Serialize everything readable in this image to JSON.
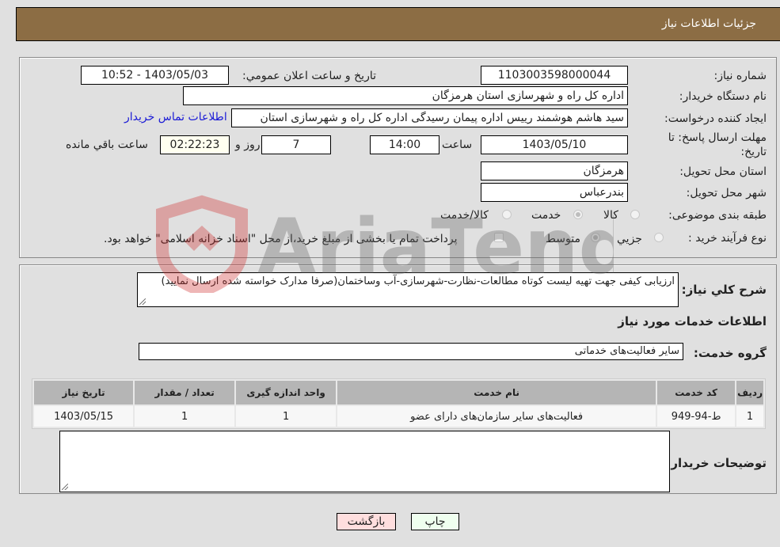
{
  "header": {
    "title": "جزئیات اطلاعات نیاز"
  },
  "form": {
    "need_number": {
      "label": "شماره نیاز:",
      "value": "1103003598000044"
    },
    "announce_datetime": {
      "label": "تاریخ و ساعت اعلان عمومي:",
      "value": "1403/05/03 - 10:52"
    },
    "buyer_org": {
      "label": "نام دستگاه خریدار:",
      "value": "اداره کل راه و شهرسازی استان هرمزگان"
    },
    "requester": {
      "label": "ایجاد کننده درخواست:",
      "value": "سید هاشم هوشمند رییس اداره پیمان رسیدگی اداره کل راه و شهرسازی استان",
      "contact_link": "اطلاعات تماس خریدار"
    },
    "deadline": {
      "label": "مهلت ارسال پاسخ: تا تاریخ:",
      "date": "1403/05/10",
      "time_label": "ساعت",
      "time": "14:00",
      "days": "7",
      "days_label": "روز و",
      "remaining": "02:22:23",
      "remaining_label": "ساعت باقي مانده"
    },
    "delivery_province": {
      "label": "استان محل تحویل:",
      "value": "هرمزگان"
    },
    "delivery_city": {
      "label": "شهر محل تحویل:",
      "value": "بندرعباس"
    },
    "category": {
      "label": "طبقه بندی موضوعی:",
      "options": [
        {
          "label": "کالا",
          "checked": false
        },
        {
          "label": "خدمت",
          "checked": true
        },
        {
          "label": "کالا/خدمت",
          "checked": false
        }
      ]
    },
    "purchase_type": {
      "label": "نوع فرآیند خرید :",
      "options": [
        {
          "label": "جزیي",
          "checked": false
        },
        {
          "label": "متوسط",
          "checked": true
        }
      ],
      "treasury_checkbox_label": "پرداخت تمام یا بخشی از مبلغ خرید،از محل \"اسناد خزانه اسلامی\" خواهد بود.",
      "treasury_checked": false
    }
  },
  "description": {
    "label": "شرح کلي نیاز:",
    "value": "ارزیابی کیفی جهت تهیه لیست کوتاه مطالعات-نظارت-شهرسازی-آب وساختمان(صرفا مدارک خواسته شده ارسال نمایید)"
  },
  "services": {
    "section_title": "اطلاعات خدمات مورد نیاز",
    "group_label": "گروه خدمت:",
    "group_value": "سایر فعالیت‌های خدماتی",
    "table": {
      "headers": [
        "ردیف",
        "کد خدمت",
        "نام خدمت",
        "واحد اندازه گیری",
        "تعداد / مقدار",
        "تاریخ نیاز"
      ],
      "rows": [
        [
          "1",
          "ط-94-949",
          "فعالیت‌های سایر سازمان‌های دارای عضو",
          "1",
          "1",
          "1403/05/15"
        ]
      ]
    }
  },
  "buyer_notes": {
    "label": "توضیحات خریدار:",
    "value": ""
  },
  "buttons": {
    "print": "چاپ",
    "back": "بازگشت"
  },
  "watermark": {
    "text": "AriaTender.neT"
  }
}
